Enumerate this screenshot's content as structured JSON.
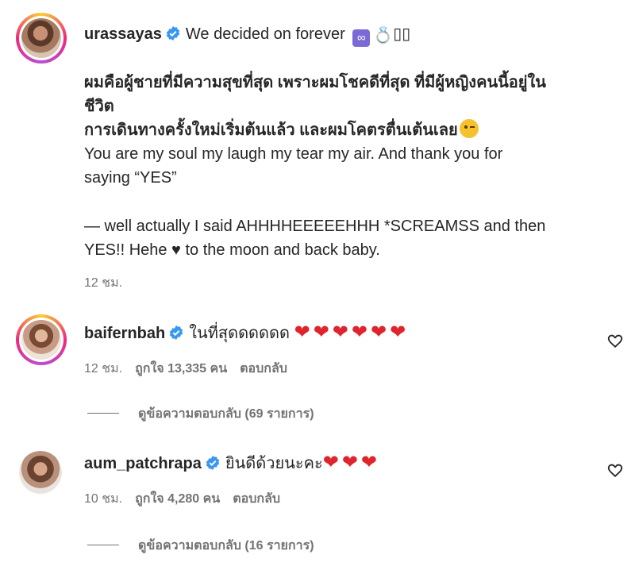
{
  "caption": {
    "username": "urassayas",
    "title_text": "We decided on forever",
    "title_emojis": "∞",
    "ring_emoji": "💍",
    "tail_squares": "▯▯",
    "body_line1": "ผมคือผู้ชายที่มีความสุขที่สุด เพราะผมโชคดีที่สุด ที่มีผู้หญิงคนนี้อยู่ใน",
    "body_line2": "ชีวิต",
    "body_line3": "การเดินทางครั้งใหม่เริ่มต้นแล้ว และผมโคตรตื่นเต้นเลย",
    "body_line4": "You are my soul my laugh my tear my air. And thank you for",
    "body_line5": "saying “YES”",
    "body_line6": "— well actually I said AHHHHEEEEEHHH *SCREAMSS and then",
    "body_line7": "YES!! Hehe ♥ to the moon and back baby.",
    "time": "12 ชม."
  },
  "comments": [
    {
      "username": "baifernbah",
      "text": "ในที่สุดดดดดด",
      "hearts": "❤❤❤❤❤❤",
      "time": "12 ชม.",
      "likes": "ถูกใจ 13,335 คน",
      "reply": "ตอบกลับ",
      "view_replies": "ดูข้อความตอบกลับ (69 รายการ)"
    },
    {
      "username": "aum_patchrapa",
      "text": "ยินดีด้วยนะคะ",
      "hearts": "❤❤❤",
      "time": "10 ชม.",
      "likes": "ถูกใจ 4,280 คน",
      "reply": "ตอบกลับ",
      "view_replies": "ดูข้อความตอบกลับ (16 รายการ)"
    }
  ],
  "colors": {
    "verified": "#3897f0",
    "heart": "#e0242d",
    "muted": "#737373"
  }
}
